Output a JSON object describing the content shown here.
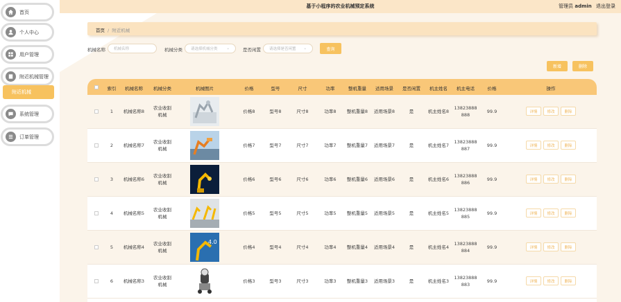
{
  "header": {
    "title": "基于小程序的农业机械预定系统",
    "user_role": "管理员",
    "user_name": "admin",
    "logout": "退出登录"
  },
  "sidebar": {
    "items": [
      {
        "label": "首页",
        "icon": "home-icon"
      },
      {
        "label": "个人中心",
        "icon": "user-icon"
      },
      {
        "label": "用户管理",
        "icon": "grid-icon"
      },
      {
        "label": "附近机械管理",
        "icon": "document-icon"
      },
      {
        "label": "系统管理",
        "icon": "chat-icon"
      },
      {
        "label": "订单管理",
        "icon": "list-icon"
      }
    ],
    "active_sub": "附近机械"
  },
  "breadcrumb": {
    "home": "首页",
    "sep": "/",
    "current": "附近机械"
  },
  "search": {
    "name_label": "机械名称",
    "name_placeholder": "机械名称",
    "category_label": "机械分类",
    "category_placeholder": "请选择机械分类",
    "idle_label": "是否闲置",
    "idle_placeholder": "请选择是否闲置",
    "search_button": "查询"
  },
  "toolbar": {
    "add_button": "新增",
    "delete_button": "删除"
  },
  "table": {
    "columns": [
      "索引",
      "机械名称",
      "机械分类",
      "机械图片",
      "价格",
      "型号",
      "尺寸",
      "功率",
      "整机重量",
      "适用场景",
      "是否闲置",
      "机主姓名",
      "机主电话",
      "价格",
      "操作"
    ],
    "actions": {
      "detail": "详情",
      "edit": "修改",
      "delete": "删除"
    },
    "rows": [
      {
        "index": "1",
        "name": "机械名称8",
        "category": [
          "农业收割",
          "机械"
        ],
        "price": "价格8",
        "model": "型号8",
        "size": "尺寸8",
        "power": "功率8",
        "weight": "整机重量8",
        "scene": "适用场景8",
        "idle": "是",
        "owner": "机主姓名8",
        "phone": [
          "13823888",
          "888"
        ],
        "price2": "99.9"
      },
      {
        "index": "2",
        "name": "机械名称7",
        "category": [
          "农业收割",
          "机械"
        ],
        "price": "价格7",
        "model": "型号7",
        "size": "尺寸7",
        "power": "功率7",
        "weight": "整机重量7",
        "scene": "适用场景7",
        "idle": "是",
        "owner": "机主姓名7",
        "phone": [
          "13823888",
          "887"
        ],
        "price2": "99.9"
      },
      {
        "index": "3",
        "name": "机械名称6",
        "category": [
          "农业收割",
          "机械"
        ],
        "price": "价格6",
        "model": "型号6",
        "size": "尺寸6",
        "power": "功率6",
        "weight": "整机重量6",
        "scene": "适用场景6",
        "idle": "是",
        "owner": "机主姓名6",
        "phone": [
          "13823888",
          "886"
        ],
        "price2": "99.9"
      },
      {
        "index": "4",
        "name": "机械名称5",
        "category": [
          "农业收割",
          "机械"
        ],
        "price": "价格5",
        "model": "型号5",
        "size": "尺寸5",
        "power": "功率5",
        "weight": "整机重量5",
        "scene": "适用场景5",
        "idle": "是",
        "owner": "机主姓名5",
        "phone": [
          "13823888",
          "885"
        ],
        "price2": "99.9"
      },
      {
        "index": "5",
        "name": "机械名称4",
        "category": [
          "农业收割",
          "机械"
        ],
        "price": "价格4",
        "model": "型号4",
        "size": "尺寸4",
        "power": "功率4",
        "weight": "整机重量4",
        "scene": "适用场景4",
        "idle": "是",
        "owner": "机主姓名4",
        "phone": [
          "13823888",
          "884"
        ],
        "price2": "99.9"
      },
      {
        "index": "6",
        "name": "机械名称3",
        "category": [
          "农业收割",
          "机械"
        ],
        "price": "价格3",
        "model": "型号3",
        "size": "尺寸3",
        "power": "功率3",
        "weight": "整机重量3",
        "scene": "适用场景3",
        "idle": "是",
        "owner": "机主姓名3",
        "phone": [
          "13823888",
          "883"
        ],
        "price2": "99.9"
      }
    ]
  },
  "colors": {
    "accent": "#f7c25f",
    "header_bg": "#fbe6c8",
    "table_head": "#f9c778",
    "row_alt": "#fbf4ea"
  }
}
